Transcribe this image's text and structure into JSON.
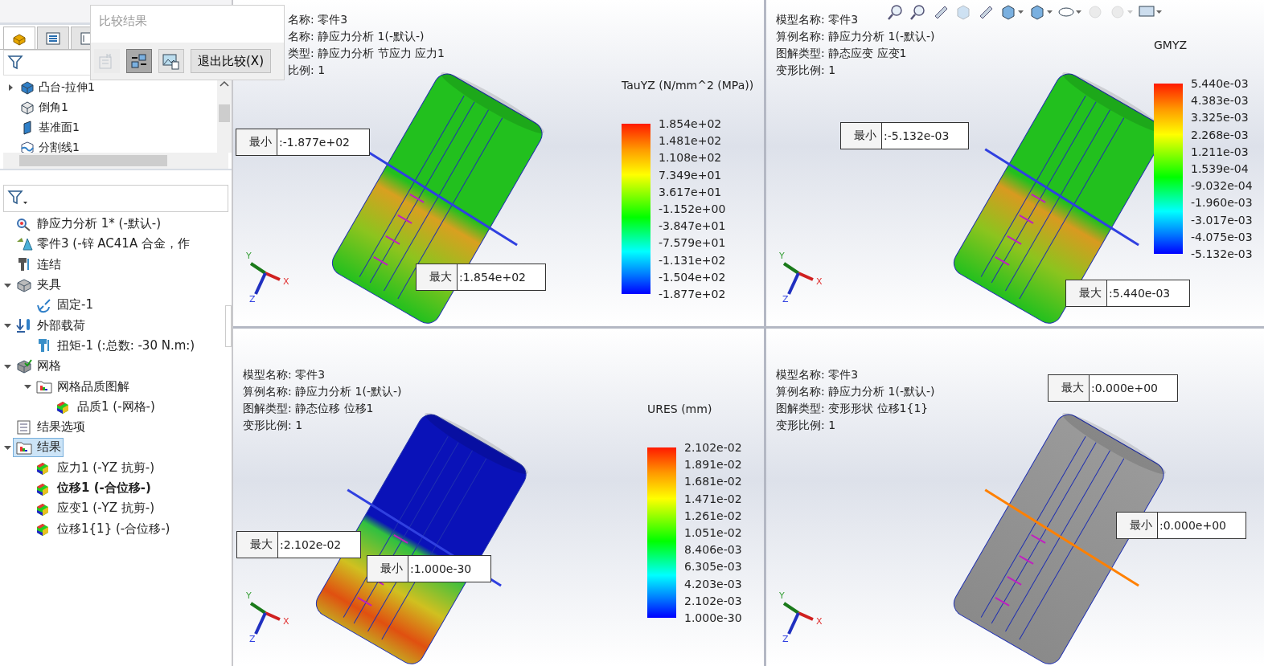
{
  "compare_popup": {
    "title": "比较结果",
    "tools": [
      {
        "kind": "frequency",
        "disabled": true,
        "selected": false
      },
      {
        "kind": "sync-views",
        "disabled": false,
        "selected": true
      },
      {
        "kind": "image-save",
        "disabled": false,
        "selected": false
      }
    ],
    "exit_button": "退出比较(X)"
  },
  "panel_tabs": [
    {
      "kind": "feature-manager",
      "selected": true
    },
    {
      "kind": "property-manager",
      "selected": false
    },
    {
      "kind": "config-manager",
      "selected": false
    }
  ],
  "feature_tree": {
    "items": [
      {
        "kind": "extrude",
        "label": "凸台-拉伸1",
        "expanded": false
      },
      {
        "kind": "chamfer",
        "label": "倒角1"
      },
      {
        "kind": "plane",
        "label": "基准面1"
      },
      {
        "kind": "split-line",
        "label": "分割线1"
      }
    ]
  },
  "study_tree": {
    "items": [
      {
        "kind": "study",
        "label": "静应力分析 1* (-默认-)",
        "selected": false
      },
      {
        "kind": "part",
        "label": "零件3 (-锌 AC41A 合金，作",
        "selected": false
      },
      {
        "kind": "connections",
        "label": "连结",
        "selected": false
      },
      {
        "kind": "fixtures",
        "label": "夹具",
        "selected": false,
        "expanded": true,
        "children": [
          {
            "kind": "fixed",
            "label": "固定-1",
            "selected": false
          }
        ]
      },
      {
        "kind": "loads",
        "label": "外部载荷",
        "selected": false,
        "expanded": true,
        "children": [
          {
            "kind": "torque",
            "label": "扭矩-1 (:总数: -30 N.m:)",
            "selected": false
          }
        ]
      },
      {
        "kind": "mesh",
        "label": "网格",
        "selected": false,
        "expanded": true,
        "children": [
          {
            "kind": "plot-folder",
            "label": "网格品质图解",
            "selected": false,
            "expanded": true,
            "children": [
              {
                "kind": "plot",
                "label": "品质1 (-网格-)",
                "selected": false
              }
            ]
          }
        ]
      },
      {
        "kind": "options",
        "label": "结果选项",
        "selected": false
      },
      {
        "kind": "plot-folder",
        "label": "结果",
        "selected": true,
        "expanded": true,
        "children": [
          {
            "kind": "plot",
            "label": "应力1 (-YZ 抗剪-)",
            "selected": false,
            "active": false
          },
          {
            "kind": "plot",
            "label": "位移1 (-合位移-)",
            "selected": false,
            "active": true
          },
          {
            "kind": "plot",
            "label": "应变1 (-YZ 抗剪-)",
            "selected": false,
            "active": false
          },
          {
            "kind": "plot",
            "label": "位移1{1} (-合位移-)",
            "selected": false,
            "active": false
          }
        ]
      }
    ]
  },
  "view_toolbar": [
    {
      "kind": "zoom-fit",
      "disabled": false,
      "dropdown": false
    },
    {
      "kind": "zoom-area",
      "disabled": false,
      "dropdown": false
    },
    {
      "kind": "previous-view",
      "disabled": false,
      "dropdown": false
    },
    {
      "kind": "section",
      "disabled": true,
      "dropdown": false
    },
    {
      "kind": "annotation",
      "disabled": false,
      "dropdown": false
    },
    {
      "kind": "orientation",
      "disabled": false,
      "dropdown": true
    },
    {
      "kind": "display-style",
      "disabled": false,
      "dropdown": true
    },
    {
      "kind": "hide-show",
      "disabled": false,
      "dropdown": true
    },
    {
      "kind": "appearance",
      "disabled": true,
      "dropdown": false
    },
    {
      "kind": "scene",
      "disabled": true,
      "dropdown": true
    },
    {
      "kind": "view-settings",
      "disabled": false,
      "dropdown": true
    }
  ],
  "viewports": [
    {
      "kind": "stress",
      "info": [
        "名称: 零件3",
        "名称: 静应力分析 1(-默认-)",
        "类型: 静应力分析 节应力 应力1",
        "比例: 1"
      ],
      "legend": {
        "title": "TauYZ (N/mm^2 (MPa))",
        "ticks": [
          "1.854e+02",
          "1.481e+02",
          "1.108e+02",
          "7.349e+01",
          "3.617e+01",
          "-1.152e+00",
          "-3.847e+01",
          "-7.579e+01",
          "-1.131e+02",
          "-1.504e+02",
          "-1.877e+02"
        ]
      },
      "callouts": [
        {
          "label": "最小",
          "value": ":-1.877e+02"
        },
        {
          "label": "最大",
          "value": ":1.854e+02"
        }
      ],
      "triad": [
        "X",
        "Y",
        "Z"
      ]
    },
    {
      "kind": "strain",
      "info": [
        "模型名称: 零件3",
        "算例名称: 静应力分析 1(-默认-)",
        "图解类型: 静态应变 应变1",
        "变形比例: 1"
      ],
      "legend": {
        "title": "GMYZ",
        "ticks": [
          "5.440e-03",
          "4.383e-03",
          "3.325e-03",
          "2.268e-03",
          "1.211e-03",
          "1.539e-04",
          "-9.032e-04",
          "-1.960e-03",
          "-3.017e-03",
          "-4.075e-03",
          "-5.132e-03"
        ]
      },
      "callouts": [
        {
          "label": "最小",
          "value": ":-5.132e-03"
        },
        {
          "label": "最大",
          "value": ":5.440e-03"
        }
      ],
      "triad": [
        "X",
        "Y",
        "Z"
      ]
    },
    {
      "kind": "displacement",
      "info": [
        "模型名称: 零件3",
        "算例名称: 静应力分析 1(-默认-)",
        "图解类型: 静态位移 位移1",
        "变形比例: 1"
      ],
      "legend": {
        "title": "URES (mm)",
        "ticks": [
          "2.102e-02",
          "1.891e-02",
          "1.681e-02",
          "1.471e-02",
          "1.261e-02",
          "1.051e-02",
          "8.406e-03",
          "6.305e-03",
          "4.203e-03",
          "2.102e-03",
          "1.000e-30"
        ]
      },
      "callouts": [
        {
          "label": "最大",
          "value": ":2.102e-02"
        },
        {
          "label": "最小",
          "value": ":1.000e-30"
        }
      ],
      "triad": [
        "X",
        "Y",
        "Z"
      ]
    },
    {
      "kind": "deformed",
      "info": [
        "模型名称: 零件3",
        "算例名称: 静应力分析 1(-默认-)",
        "图解类型: 变形形状 位移1{1}",
        "变形比例: 1"
      ],
      "callouts": [
        {
          "label": "最大",
          "value": ":0.000e+00"
        },
        {
          "label": "最小",
          "value": ":0.000e+00"
        }
      ],
      "triad": [
        "X",
        "Y",
        "Z"
      ]
    }
  ]
}
